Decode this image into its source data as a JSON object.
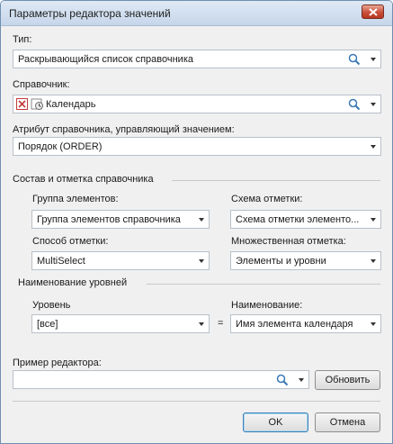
{
  "window": {
    "title": "Параметры редактора значений"
  },
  "type": {
    "label": "Тип:",
    "value": "Раскрывающийся список справочника"
  },
  "reference": {
    "label": "Справочник:",
    "value": "Календарь"
  },
  "attribute": {
    "label": "Атрибут справочника, управляющий значением:",
    "value": "Порядок (ORDER)"
  },
  "composition": {
    "header": "Состав и отметка справочника",
    "group_label": "Группа элементов:",
    "group_value": "Группа элементов справочника",
    "scheme_label": "Схема отметки:",
    "scheme_value": "Схема отметки элементо...",
    "method_label": "Способ отметки:",
    "method_value": "MultiSelect",
    "multi_label": "Множественная отметка:",
    "multi_value": "Элементы и уровни"
  },
  "levels": {
    "header": "Наименование уровней",
    "level_label": "Уровень",
    "level_value": "[все]",
    "equals": "=",
    "name_label": "Наименование:",
    "name_value": "Имя элемента календаря"
  },
  "example": {
    "label": "Пример редактора:",
    "value": "",
    "refresh_label": "Обновить"
  },
  "footer": {
    "ok_label": "OK",
    "cancel_label": "Отмена"
  }
}
